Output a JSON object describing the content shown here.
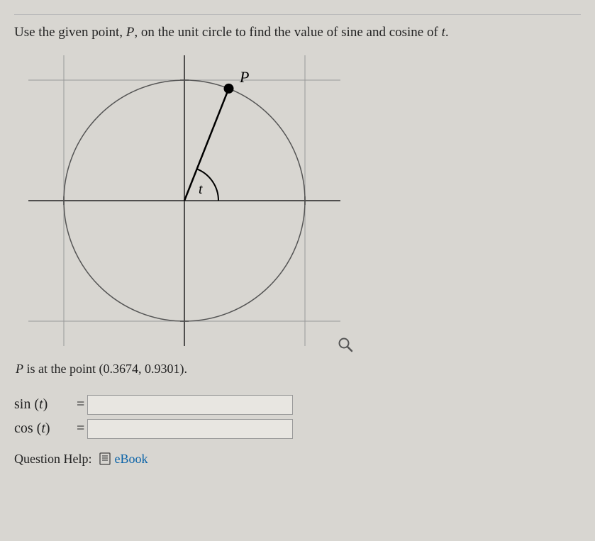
{
  "prompt": {
    "pre": "Use the given point, ",
    "var_p": "P",
    "mid": ", on the unit circle to find the value of sine and cosine of ",
    "var_t": "t",
    "post": "."
  },
  "diagram": {
    "label_p": "P",
    "label_t": "t"
  },
  "point_statement": {
    "pre": "P",
    "mid": " is at the point ",
    "coords": "(0.3674, 0.9301)",
    "post": "."
  },
  "answers": {
    "sin_label_func": "sin",
    "cos_label_func": "cos",
    "var": "t",
    "sin_value": "",
    "cos_value": ""
  },
  "help": {
    "label": "Question Help:",
    "link": "eBook"
  },
  "chart_data": {
    "type": "diagram",
    "description": "Unit circle with coordinate axes, bounding square at ±1, point P in first quadrant, radius from origin to P, angle arc labeled t",
    "point_P": {
      "x": 0.3674,
      "y": 0.9301
    },
    "radius": 1,
    "axis_ticks": [
      -1,
      1
    ]
  }
}
